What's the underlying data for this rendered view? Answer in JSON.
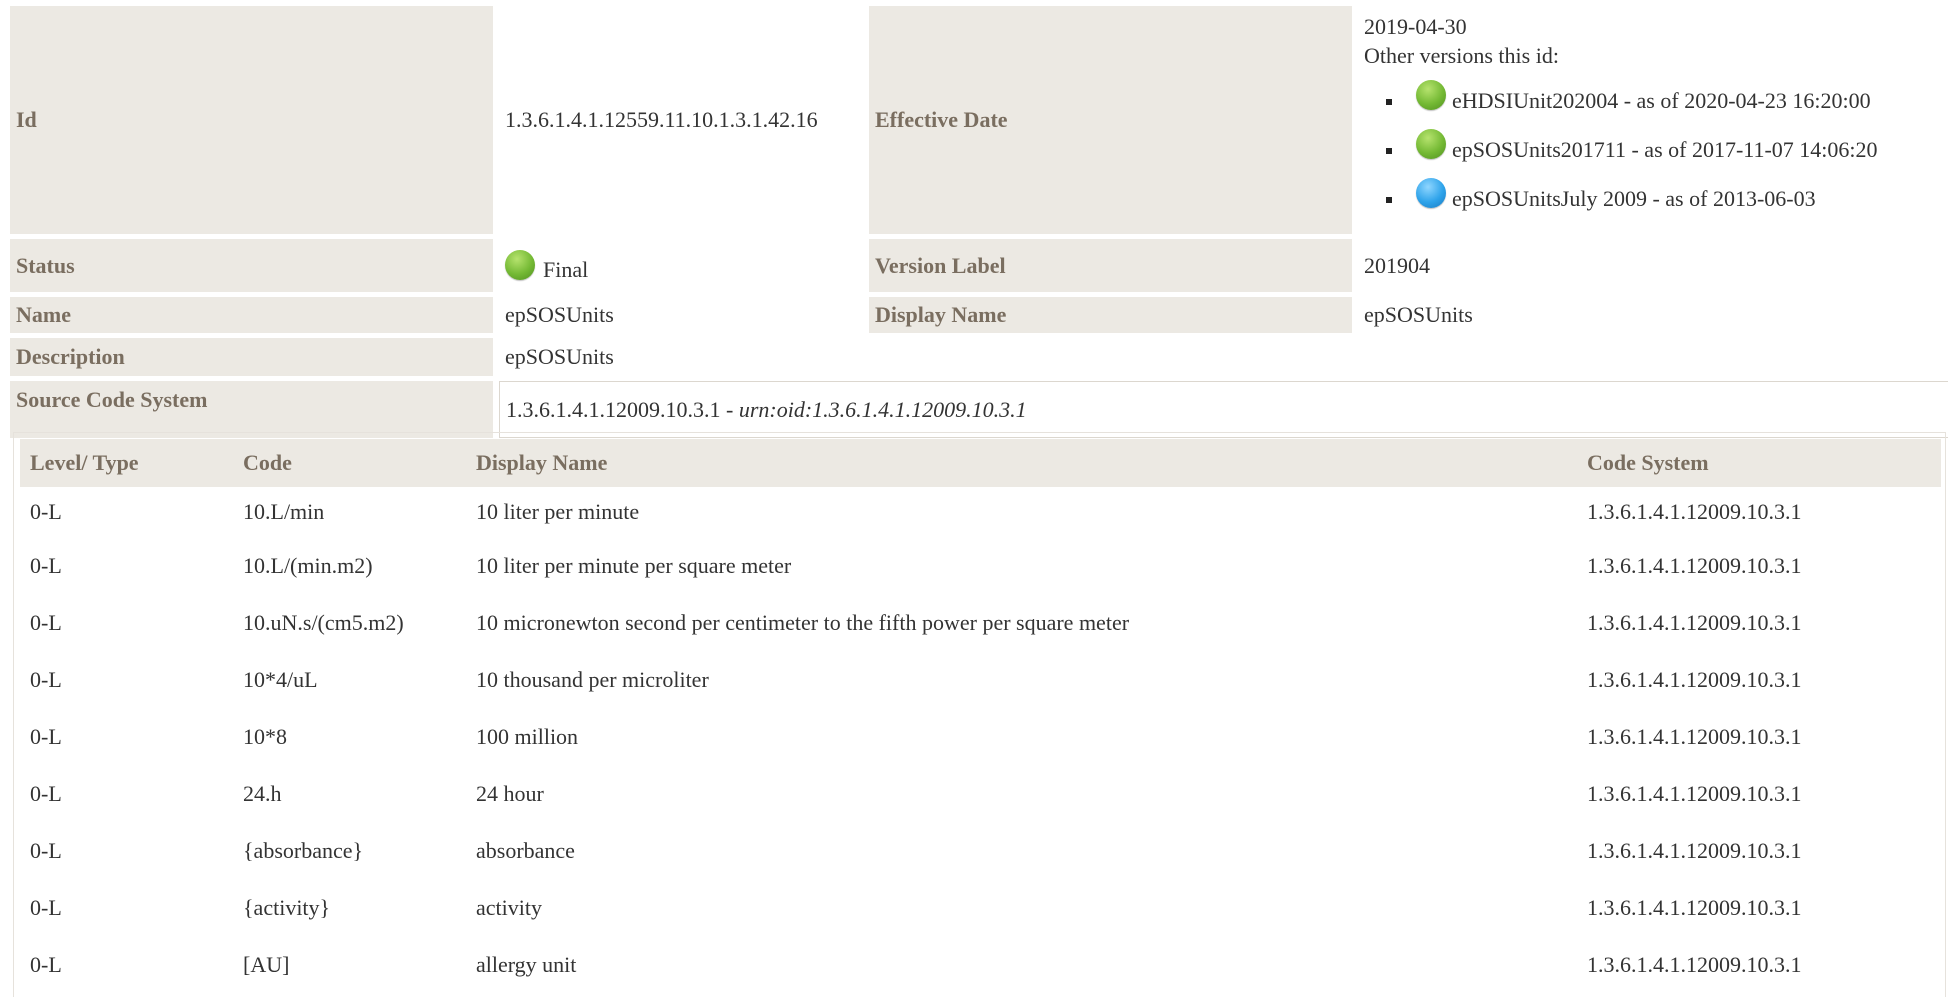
{
  "meta": {
    "id_label": "Id",
    "id_value": "1.3.6.1.4.1.12559.11.10.1.3.1.42.16",
    "effective_date_label": "Effective Date",
    "effective_date_value": "2019-04-30",
    "other_versions_label": "Other versions this id:",
    "other_versions": [
      {
        "text": "eHDSIUnit202004 - as of 2020-04-23 16:20:00",
        "status_color": "#74b934"
      },
      {
        "text": "epSOSUnits201711 - as of 2017-11-07 14:06:20",
        "status_color": "#74b934"
      },
      {
        "text": "epSOSUnitsJuly 2009 - as of 2013-06-03",
        "status_color": "#2ea3ea"
      }
    ],
    "status_label": "Status",
    "status_value": "Final",
    "status_icon": "green-status-dot",
    "version_label_label": "Version Label",
    "version_label_value": "201904",
    "name_label": "Name",
    "name_value": "epSOSUnits",
    "display_name_label": "Display Name",
    "display_name_value": "epSOSUnits",
    "description_label": "Description",
    "description_value": "epSOSUnits",
    "source_code_system_label": "Source Code System",
    "source_code_system_id": "1.3.6.1.4.1.12009.10.3.1",
    "source_code_system_separator": " - ",
    "source_code_system_urn": "urn:oid:1.3.6.1.4.1.12009.10.3.1"
  },
  "codes_table": {
    "headers": {
      "level_type": "Level/ Type",
      "code": "Code",
      "display_name": "Display Name",
      "code_system": "Code System"
    },
    "rows": [
      {
        "level_type": "0-L",
        "code": "10.L/min",
        "display_name": "10 liter per minute",
        "code_system": "1.3.6.1.4.1.12009.10.3.1"
      },
      {
        "level_type": "0-L",
        "code": "10.L/(min.m2)",
        "display_name": "10 liter per minute per square meter",
        "code_system": "1.3.6.1.4.1.12009.10.3.1"
      },
      {
        "level_type": "0-L",
        "code": "10.uN.s/(cm5.m2)",
        "display_name": "10 micronewton second per centimeter to the fifth power per square meter",
        "code_system": "1.3.6.1.4.1.12009.10.3.1"
      },
      {
        "level_type": "0-L",
        "code": "10*4/uL",
        "display_name": "10 thousand per microliter",
        "code_system": "1.3.6.1.4.1.12009.10.3.1"
      },
      {
        "level_type": "0-L",
        "code": "10*8",
        "display_name": "100 million",
        "code_system": "1.3.6.1.4.1.12009.10.3.1"
      },
      {
        "level_type": "0-L",
        "code": "24.h",
        "display_name": "24 hour",
        "code_system": "1.3.6.1.4.1.12009.10.3.1"
      },
      {
        "level_type": "0-L",
        "code": "{absorbance}",
        "display_name": "absorbance",
        "code_system": "1.3.6.1.4.1.12009.10.3.1"
      },
      {
        "level_type": "0-L",
        "code": "{activity}",
        "display_name": "activity",
        "code_system": "1.3.6.1.4.1.12009.10.3.1"
      },
      {
        "level_type": "0-L",
        "code": "[AU]",
        "display_name": "allergy unit",
        "code_system": "1.3.6.1.4.1.12009.10.3.1"
      }
    ]
  }
}
